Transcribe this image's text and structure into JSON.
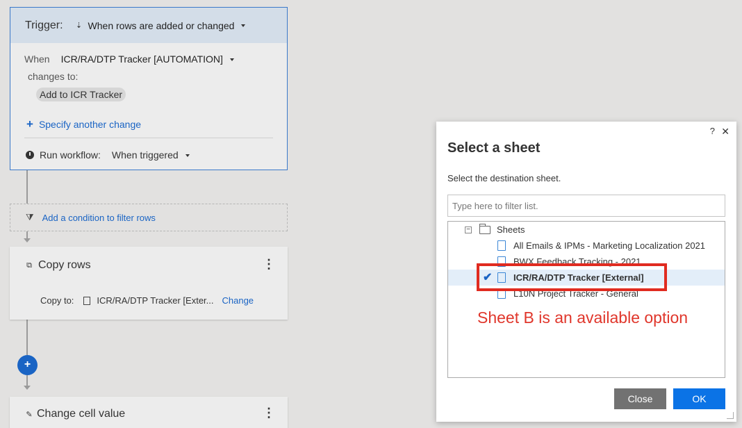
{
  "trigger": {
    "label": "Trigger:",
    "type_label": "When rows are added or changed",
    "when_label": "When",
    "when_sheet": "ICR/RA/DTP Tracker [AUTOMATION]",
    "changes_to_label": "changes to:",
    "chip_value": "Add to ICR Tracker",
    "specify_plus": "+",
    "specify_label": "Specify another change",
    "run_label": "Run workflow:",
    "run_value": "When triggered"
  },
  "condition": {
    "label": "Add a condition to filter rows"
  },
  "copy_rows": {
    "title": "Copy rows",
    "copy_to_label": "Copy to:",
    "copy_to_value": "ICR/RA/DTP Tracker [Exter...",
    "change_link": "Change",
    "menu": "⋮"
  },
  "add_step": "+",
  "change_cell": {
    "title": "Change cell value",
    "menu": "⋮"
  },
  "dialog": {
    "help": "?",
    "close_icon": "✕",
    "title": "Select a sheet",
    "subtitle": "Select the destination sheet.",
    "filter_placeholder": "Type here to filter list.",
    "tree_root": "Sheets",
    "tree_root_toggle": "−",
    "selected_check": "✔",
    "items": [
      {
        "label": "All Emails & IPMs - Marketing Localization 2021"
      },
      {
        "label": "BWX Feedback Tracking - 2021"
      },
      {
        "label": "ICR/RA/DTP Tracker [External]",
        "selected": true
      },
      {
        "label": "L10N Project Tracker - General"
      }
    ],
    "close_button": "Close",
    "ok_button": "OK"
  },
  "annotation": {
    "text": "Sheet B is an available option",
    "color": "#e02b20"
  },
  "colors": {
    "accent": "#1a64c4",
    "trigger_header": "#d3dde8",
    "ok_button": "#0b73e6",
    "close_button": "#727272"
  }
}
